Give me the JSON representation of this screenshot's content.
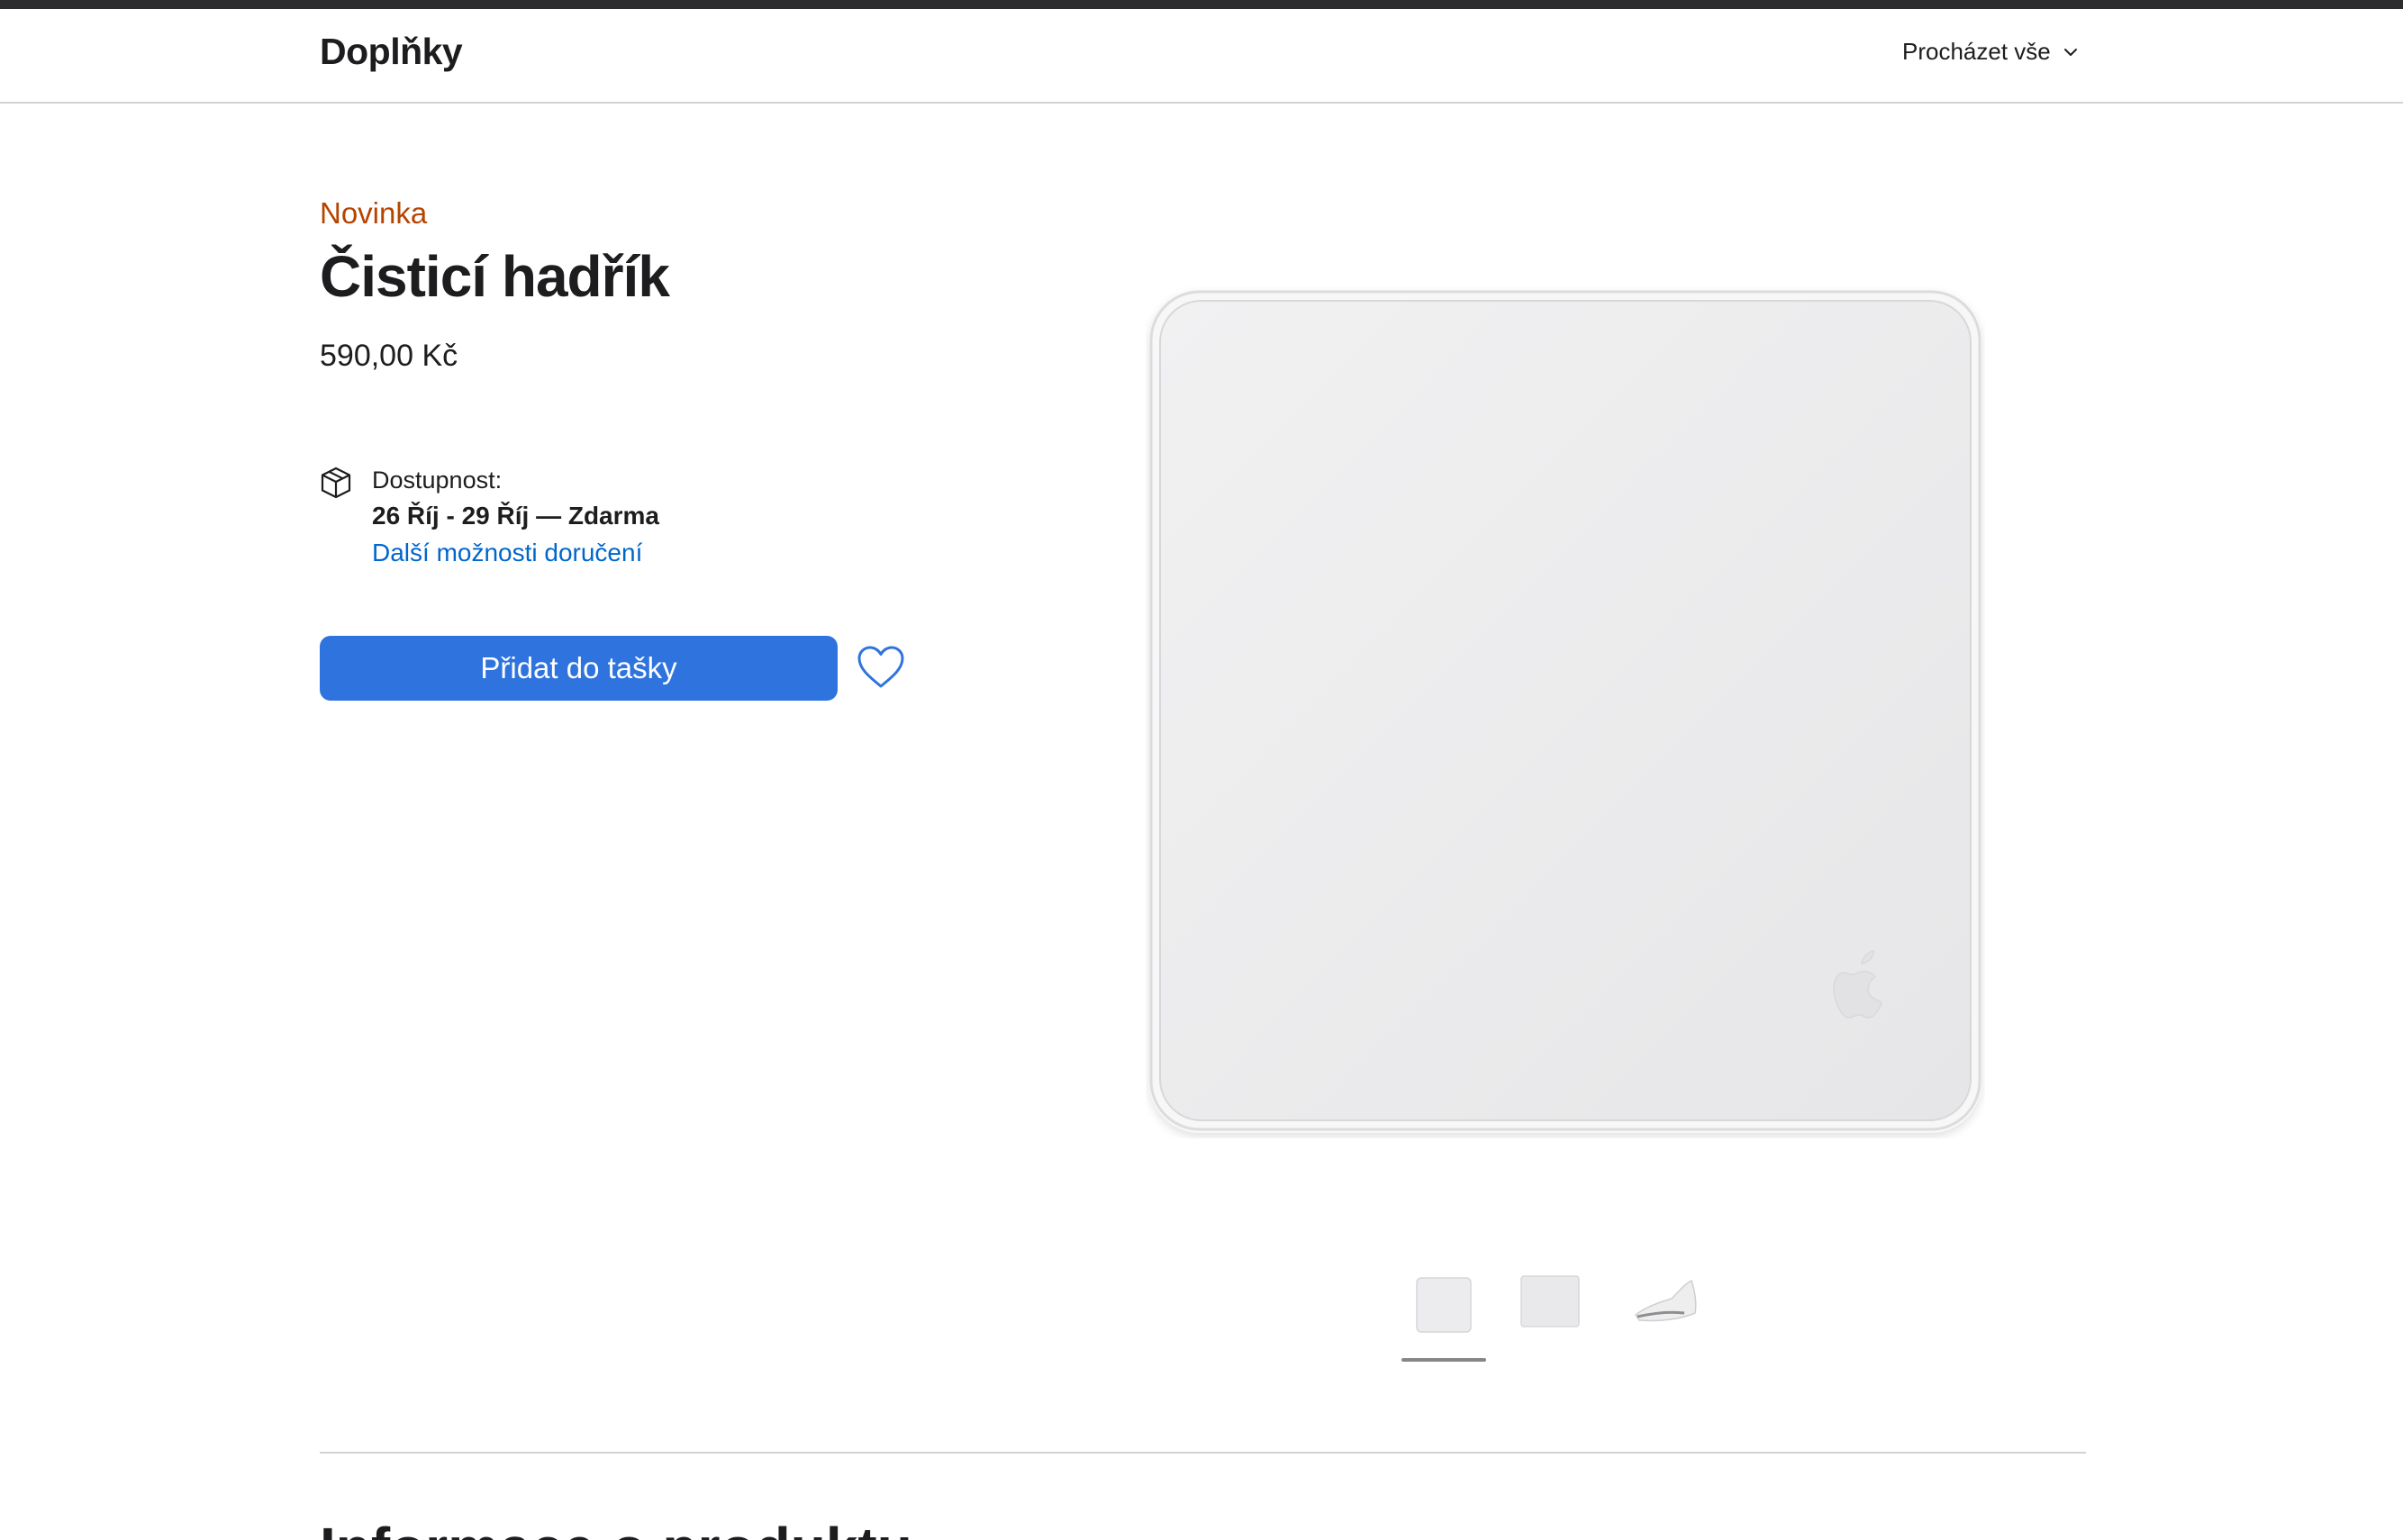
{
  "nav": {
    "brand": "Doplňky",
    "browse_label": "Procházet vše"
  },
  "product": {
    "eyebrow": "Novinka",
    "title": "Čisticí hadřík",
    "price": "590,00 Kč"
  },
  "availability": {
    "label": "Dostupnost:",
    "dates": "26 Říj - 29 Říj — Zdarma",
    "more_link": "Další možnosti doručení"
  },
  "actions": {
    "add_to_bag": "Přidat do tašky"
  },
  "gallery": {
    "selected_index": 0,
    "thumbnail_count": 3
  },
  "section": {
    "heading_partial": "Informace o produktu"
  },
  "colors": {
    "accent": "#2f74de",
    "link": "#0066cc",
    "eyebrow": "#b64400",
    "text": "#1d1d1f",
    "topbar": "#2d2d2f"
  },
  "icons": {
    "browse": "chevron-down-icon",
    "availability": "package-box-icon",
    "favorite": "heart-outline-icon",
    "brand_mark": "apple-logo-icon"
  }
}
